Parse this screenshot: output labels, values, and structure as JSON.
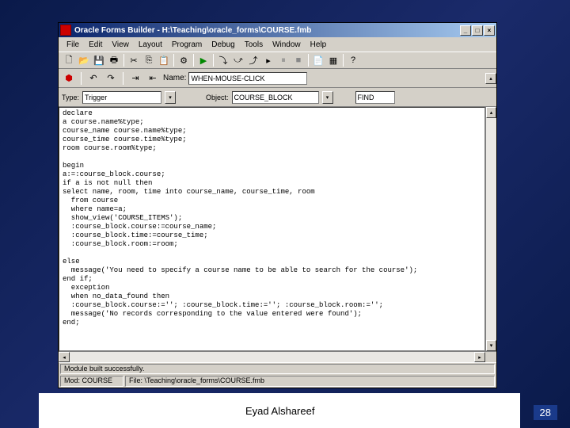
{
  "slide": {
    "author": "Eyad Alshareef",
    "page_number": "28"
  },
  "window": {
    "title": "Oracle Forms Builder - H:\\Teaching\\oracle_forms\\COURSE.fmb"
  },
  "menu": {
    "items": [
      "File",
      "Edit",
      "View",
      "Layout",
      "Program",
      "Debug",
      "Tools",
      "Window",
      "Help"
    ]
  },
  "toolbar2": {
    "name_label": "Name:",
    "name_value": "WHEN-MOUSE-CLICK"
  },
  "row3": {
    "type_label": "Type:",
    "type_value": "Trigger",
    "object_label": "Object:",
    "object_value": "COURSE_BLOCK",
    "extra": "FIND"
  },
  "code": {
    "text": "declare\na course.name%type;\ncourse_name course.name%type;\ncourse_time course.time%type;\nroom course.room%type;\n\nbegin\na:=:course_block.course;\nif a is not null then\nselect name, room, time into course_name, course_time, room\n  from course\n  where name=a;\n  show_view('COURSE_ITEMS');\n  :course_block.course:=course_name;\n  :course_block.time:=course_time;\n  :course_block.room:=room;\n\nelse\n  message('You need to specify a course name to be able to search for the course');\nend if;\n  exception\n  when no_data_found then\n  :course_block.course:=''; :course_block.time:=''; :course_block.room:='';\n  message('No records corresponding to the value entered were found');\nend;"
  },
  "status": {
    "line1": "Module built successfully.",
    "line2_a": "Mod: COURSE",
    "line2_b": "File: \\Teaching\\oracle_forms\\COURSE.fmb"
  }
}
